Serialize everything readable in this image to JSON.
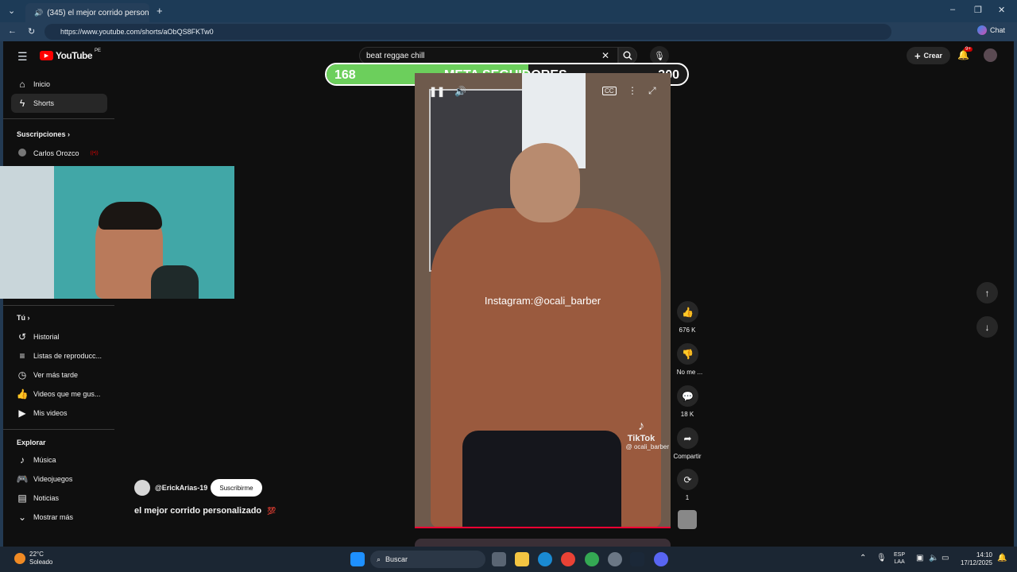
{
  "browser": {
    "tab_title": "(345) el mejor corrido person...",
    "url": "https://www.youtube.com/shorts/aObQS8FKTw0"
  },
  "header": {
    "logo": "YouTube",
    "region": "PE",
    "search_value": "beat reggae chill",
    "create_label": "Crear",
    "notif_count": "9+"
  },
  "sidebar": {
    "items": [
      {
        "label": "Inicio",
        "icon": "home-icon"
      },
      {
        "label": "Shorts",
        "icon": "shorts-icon"
      }
    ],
    "subs_header": "Suscripciones",
    "subs": [
      {
        "label": "Carlos Orozco"
      }
    ],
    "you_header": "Tú",
    "you_items": [
      {
        "label": "Historial"
      },
      {
        "label": "Listas de reproducc..."
      },
      {
        "label": "Ver más tarde"
      },
      {
        "label": "Videos que me gus..."
      },
      {
        "label": "Mis videos"
      }
    ],
    "explore_header": "Explorar",
    "explore_items": [
      {
        "label": "Música"
      },
      {
        "label": "Videojuegos"
      },
      {
        "label": "Noticias"
      },
      {
        "label": "Mostrar más"
      }
    ]
  },
  "overlay": {
    "current": "168",
    "label": "META SEGUIDORES",
    "goal": "300",
    "progress": 0.56
  },
  "video": {
    "caption": "Instagram:@ocali_barber",
    "watermark": "TikTok",
    "watermark_user": "@ ocali_barber"
  },
  "short": {
    "channel": "@ErickArias-19",
    "subscribe": "Suscribirme",
    "title": "el mejor corrido personalizado"
  },
  "actions": {
    "likes": "676 K",
    "dislike": "No me ...",
    "comments": "18 K",
    "share": "Compartir",
    "remix": "1"
  },
  "taskbar": {
    "temp": "22°C",
    "weather": "Soleado",
    "search": "Buscar",
    "lang1": "ESP",
    "lang2": "LAA",
    "time": "14:10",
    "date": "17/12/2025"
  }
}
